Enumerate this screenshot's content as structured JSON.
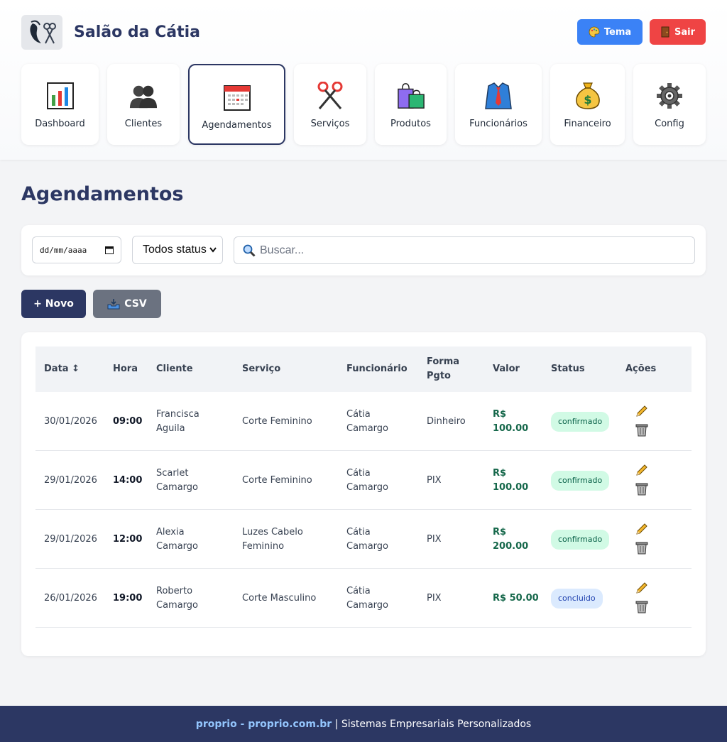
{
  "header": {
    "title": "Salão da Cátia",
    "logo_icon": "salon-logo-icon",
    "theme_button": "Tema",
    "logout_button": "Sair"
  },
  "nav": [
    {
      "label": "Dashboard",
      "icon": "bar-chart-icon"
    },
    {
      "label": "Clientes",
      "icon": "people-icon"
    },
    {
      "label": "Agendamentos",
      "icon": "calendar-icon",
      "active": true
    },
    {
      "label": "Serviços",
      "icon": "scissors-icon"
    },
    {
      "label": "Produtos",
      "icon": "shopping-bags-icon"
    },
    {
      "label": "Funcionários",
      "icon": "shirt-tie-icon"
    },
    {
      "label": "Financeiro",
      "icon": "money-bag-icon"
    },
    {
      "label": "Config",
      "icon": "gear-icon"
    }
  ],
  "page": {
    "title": "Agendamentos"
  },
  "filters": {
    "date_placeholder": "dd/mm/aaaa",
    "status_selected": "Todos status",
    "search_placeholder": "Buscar..."
  },
  "actions": {
    "new_label": "+ Novo",
    "csv_label": "CSV"
  },
  "table": {
    "headers": {
      "data": "Data ↕",
      "hora": "Hora",
      "cliente": "Cliente",
      "servico": "Serviço",
      "funcionario": "Funcionário",
      "forma_pgto": "Forma Pgto",
      "valor": "Valor",
      "status": "Status",
      "acoes": "Ações"
    },
    "rows": [
      {
        "data": "30/01/2026",
        "hora": "09:00",
        "cliente": "Francisca Aguila",
        "servico": "Corte Feminino",
        "funcionario": "Cátia Camargo",
        "forma_pgto": "Dinheiro",
        "valor": "R$ 100.00",
        "status": "confirmado"
      },
      {
        "data": "29/01/2026",
        "hora": "14:00",
        "cliente": "Scarlet Camargo",
        "servico": "Corte Feminino",
        "funcionario": "Cátia Camargo",
        "forma_pgto": "PIX",
        "valor": "R$ 100.00",
        "status": "confirmado"
      },
      {
        "data": "29/01/2026",
        "hora": "12:00",
        "cliente": "Alexia Camargo",
        "servico": "Luzes Cabelo Feminino",
        "funcionario": "Cátia Camargo",
        "forma_pgto": "PIX",
        "valor": "R$ 200.00",
        "status": "confirmado"
      },
      {
        "data": "26/01/2026",
        "hora": "19:00",
        "cliente": "Roberto Camargo",
        "servico": "Corte Masculino",
        "funcionario": "Cátia Camargo",
        "forma_pgto": "PIX",
        "valor": "R$ 50.00",
        "status": "concluido"
      }
    ]
  },
  "footer": {
    "brand": "proprio - proprio.com.br",
    "separator": " | ",
    "tagline": "Sistemas Empresariais Personalizados"
  },
  "colors": {
    "primary": "#2c3763",
    "theme_button": "#3b82f6",
    "logout_button": "#ef4444",
    "csv_button": "#6b7280",
    "money_text": "#16684b",
    "badge_confirmado": "#d1fae5",
    "badge_concluido": "#dbeafe"
  }
}
